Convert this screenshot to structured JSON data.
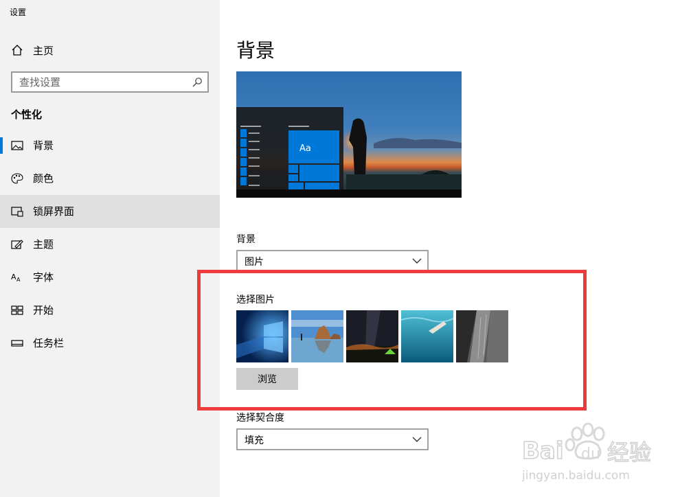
{
  "window": {
    "title": "设置"
  },
  "sidebar": {
    "home_label": "主页",
    "search_placeholder": "查找设置",
    "section_title": "个性化",
    "items": [
      {
        "label": "背景",
        "icon": "picture-icon",
        "selected": true
      },
      {
        "label": "颜色",
        "icon": "palette-icon"
      },
      {
        "label": "锁屏界面",
        "icon": "lock-screen-icon",
        "hovered": true
      },
      {
        "label": "主题",
        "icon": "theme-icon"
      },
      {
        "label": "字体",
        "icon": "font-icon"
      },
      {
        "label": "开始",
        "icon": "start-icon"
      },
      {
        "label": "任务栏",
        "icon": "taskbar-icon"
      }
    ]
  },
  "main": {
    "page_title": "背景",
    "preview": {
      "tile_text": "Aa"
    },
    "background_label": "背景",
    "background_value": "图片",
    "choose_label": "选择图片",
    "thumbnails": [
      "windows-blue-thumbnail",
      "beach-rocks-thumbnail",
      "night-sky-tent-thumbnail",
      "underwater-swimmer-thumbnail",
      "rock-cliff-thumbnail"
    ],
    "browse_label": "浏览",
    "fit_label": "选择契合度",
    "fit_value": "填充"
  },
  "watermark": {
    "brand": "Bai",
    "brand_suffix": "du",
    "product": "经验",
    "url": "jingyan.baidu.com"
  },
  "colors": {
    "accent": "#0078d7",
    "highlight_box": "#ee3b3b",
    "sidebar_bg": "#f2f2f2"
  }
}
